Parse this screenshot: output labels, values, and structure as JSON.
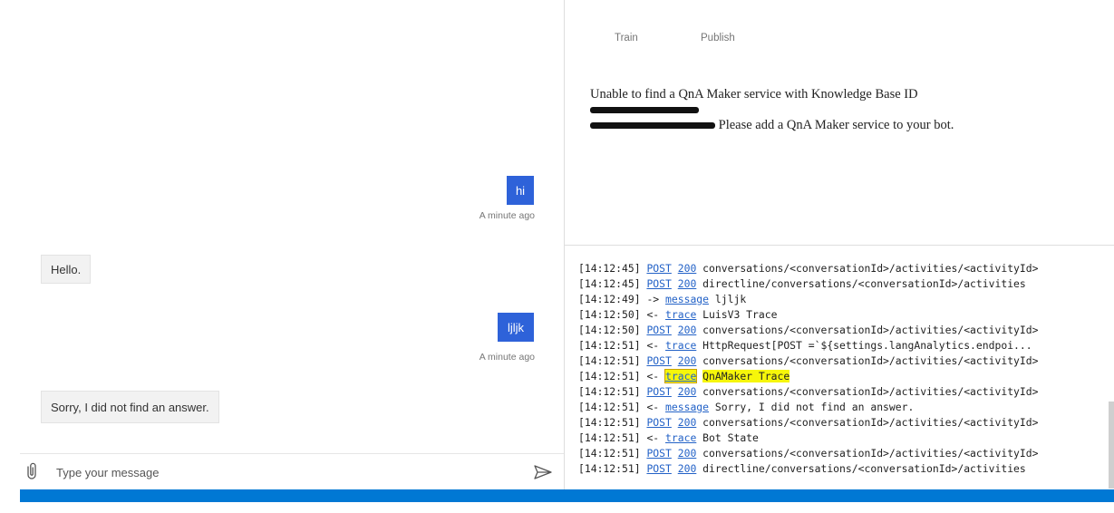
{
  "chat": {
    "messages": [
      {
        "from": "user",
        "text": "hi",
        "time": "A minute ago"
      },
      {
        "from": "bot",
        "text": "Hello."
      },
      {
        "from": "user",
        "text": "ljljk",
        "time": "A minute ago"
      },
      {
        "from": "bot",
        "text": "Sorry, I did not find an answer."
      }
    ],
    "input_placeholder": "Type your message",
    "icons": {
      "attach": "paperclip-icon",
      "send": "send-icon"
    }
  },
  "inspector": {
    "train_label": "Train",
    "publish_label": "Publish",
    "error_part1": "Unable to find a QnA Maker service with Knowledge Base ID",
    "error_part2": "Please add a QnA Maker service to your bot."
  },
  "log": {
    "lines": [
      {
        "time": "[14:12:45]",
        "arrow": "",
        "kw": "POST",
        "status": "200",
        "text": "conversations/<conversationId>/activities/<activityId>"
      },
      {
        "time": "[14:12:45]",
        "arrow": "",
        "kw": "POST",
        "status": "200",
        "text": "directline/conversations/<conversationId>/activities"
      },
      {
        "time": "[14:12:49]",
        "arrow": "->",
        "kw": "message",
        "status": "",
        "text": "ljljk"
      },
      {
        "time": "[14:12:50]",
        "arrow": "<-",
        "kw": "trace",
        "status": "",
        "text": "LuisV3 Trace"
      },
      {
        "time": "[14:12:50]",
        "arrow": "",
        "kw": "POST",
        "status": "200",
        "text": "conversations/<conversationId>/activities/<activityId>"
      },
      {
        "time": "[14:12:51]",
        "arrow": "<-",
        "kw": "trace",
        "status": "",
        "text": "HttpRequest[POST =`${settings.langAnalytics.endpoi..."
      },
      {
        "time": "[14:12:51]",
        "arrow": "",
        "kw": "POST",
        "status": "200",
        "text": "conversations/<conversationId>/activities/<activityId>"
      },
      {
        "time": "[14:12:51]",
        "arrow": "<-",
        "kw": "trace",
        "status": "",
        "text": "QnAMaker Trace",
        "highlight": true
      },
      {
        "time": "[14:12:51]",
        "arrow": "",
        "kw": "POST",
        "status": "200",
        "text": "conversations/<conversationId>/activities/<activityId>"
      },
      {
        "time": "[14:12:51]",
        "arrow": "<-",
        "kw": "message",
        "status": "",
        "text": "Sorry, I did not find an answer."
      },
      {
        "time": "[14:12:51]",
        "arrow": "",
        "kw": "POST",
        "status": "200",
        "text": "conversations/<conversationId>/activities/<activityId>"
      },
      {
        "time": "[14:12:51]",
        "arrow": "<-",
        "kw": "trace",
        "status": "",
        "text": "Bot State"
      },
      {
        "time": "[14:12:51]",
        "arrow": "",
        "kw": "POST",
        "status": "200",
        "text": "conversations/<conversationId>/activities/<activityId>"
      },
      {
        "time": "[14:12:51]",
        "arrow": "",
        "kw": "POST",
        "status": "200",
        "text": "directline/conversations/<conversationId>/activities"
      }
    ]
  },
  "colors": {
    "user_bubble": "#2e62d9",
    "status_bar": "#0078d4",
    "log_link": "#2362c7",
    "highlight": "#f6f60a"
  }
}
